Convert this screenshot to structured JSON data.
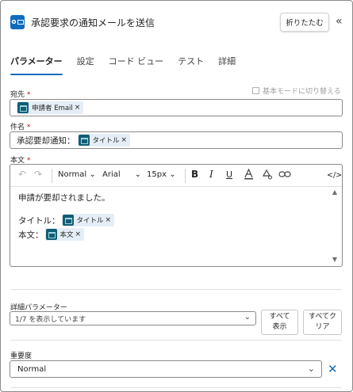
{
  "header": {
    "title": "承認要求の通知メールを送信",
    "collapse_label": "折りたたむ",
    "collapse_icon": "chevron-double-left-icon"
  },
  "tabs": [
    {
      "label": "パラメーター",
      "active": true
    },
    {
      "label": "設定",
      "active": false
    },
    {
      "label": "コード ビュー",
      "active": false
    },
    {
      "label": "テスト",
      "active": false
    },
    {
      "label": "詳細",
      "active": false
    }
  ],
  "to_field": {
    "label": "宛先",
    "required_mark": "*",
    "basic_mode_label": "基本モードに切り替える",
    "chip_label": "申請者 Email",
    "chip_remove": "×"
  },
  "subject_field": {
    "label": "件名",
    "required_mark": "*",
    "prefix_text": "承認要却通知：",
    "chip_label": "タイトル",
    "chip_remove": "×"
  },
  "body_field": {
    "label": "本文",
    "required_mark": "*",
    "toolbar": {
      "undo_icon": "↶",
      "redo_icon": "↷",
      "font_style": "Normal",
      "font_family": "Arial",
      "font_size": "15px",
      "bold": "B",
      "italic": "I",
      "underline": "U",
      "code_view": "</>"
    },
    "line1": "申請が要却されました。",
    "line2_label": "タイトル：",
    "line2_chip": "タイトル",
    "line3_label": "本文：",
    "line3_chip": "本文",
    "chip_remove": "×"
  },
  "advanced": {
    "label": "詳細パラメーター",
    "select_value": "1/7 を表示しています",
    "show_all_label_1": "すべて",
    "show_all_label_2": "表示",
    "clear_all_label_1": "すべてク",
    "clear_all_label_2": "リア"
  },
  "importance": {
    "label": "重要度",
    "value": "Normal",
    "clear_icon": "✕"
  },
  "colors": {
    "accent": "#0f6cbd",
    "required": "#c50f1f",
    "token_bg": "#105e75",
    "chip_bg": "#e5eef6"
  }
}
